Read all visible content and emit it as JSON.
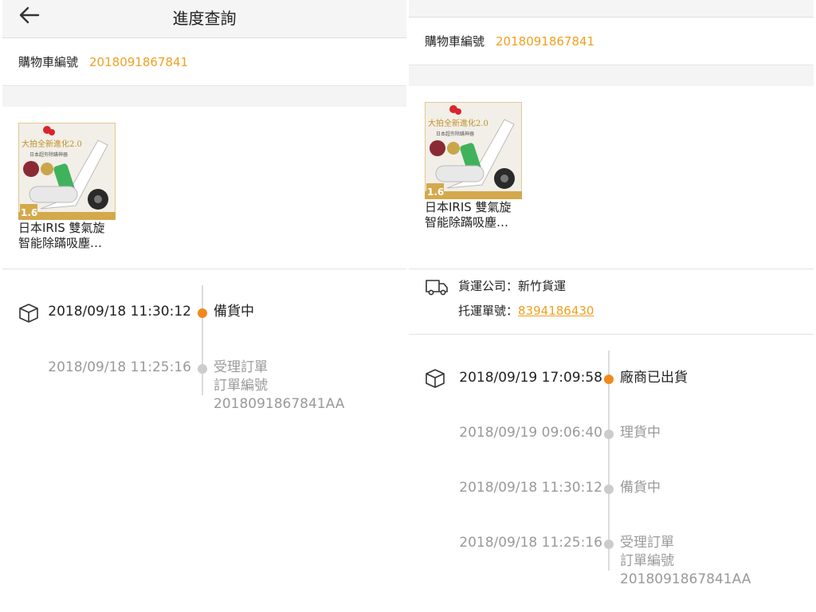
{
  "left": {
    "header": {
      "title": "進度查詢"
    },
    "cart": {
      "label": "購物車編號",
      "number": "2018091867841"
    },
    "product": {
      "name_line1": "日本IRIS 雙氣旋",
      "name_line2": "智能除蹣吸塵…",
      "image_text": {
        "headline": "大拍全新進化2.0",
        "sub": "日本超夯除蹣神器",
        "badge": "1.6"
      }
    },
    "timeline": [
      {
        "time": "2018/09/18 11:30:12",
        "status": "備貨中",
        "active": true
      },
      {
        "time": "2018/09/18 11:25:16",
        "status": "受理訂單",
        "detail_label": "訂單編號",
        "detail_value": "2018091867841AA",
        "active": false
      }
    ]
  },
  "right": {
    "cart": {
      "label": "購物車編號",
      "number": "2018091867841"
    },
    "product": {
      "name_line1": "日本IRIS 雙氣旋",
      "name_line2": "智能除蹣吸塵…",
      "image_text": {
        "headline": "大拍全新進化2.0",
        "sub": "日本超夯除蹣神器",
        "badge": "1.6"
      }
    },
    "shipping": {
      "company_label": "貨運公司：",
      "company": "新竹貨運",
      "tracking_label": "托運單號：",
      "tracking_number": "8394186430"
    },
    "timeline": [
      {
        "time": "2018/09/19 17:09:58",
        "status": "廠商已出貨",
        "active": true
      },
      {
        "time": "2018/09/19 09:06:40",
        "status": "理貨中",
        "active": false
      },
      {
        "time": "2018/09/18 11:30:12",
        "status": "備貨中",
        "active": false
      },
      {
        "time": "2018/09/18 11:25:16",
        "status": "受理訂單",
        "detail_label": "訂單編號",
        "detail_value": "2018091867841AA",
        "active": false
      }
    ]
  },
  "colors": {
    "accent": "#f0a020",
    "active_dot": "#f2891c",
    "inactive_dot": "#cccccc",
    "muted_text": "#9a9a9a"
  },
  "icons": [
    "back-arrow-icon",
    "package-icon",
    "truck-icon"
  ]
}
